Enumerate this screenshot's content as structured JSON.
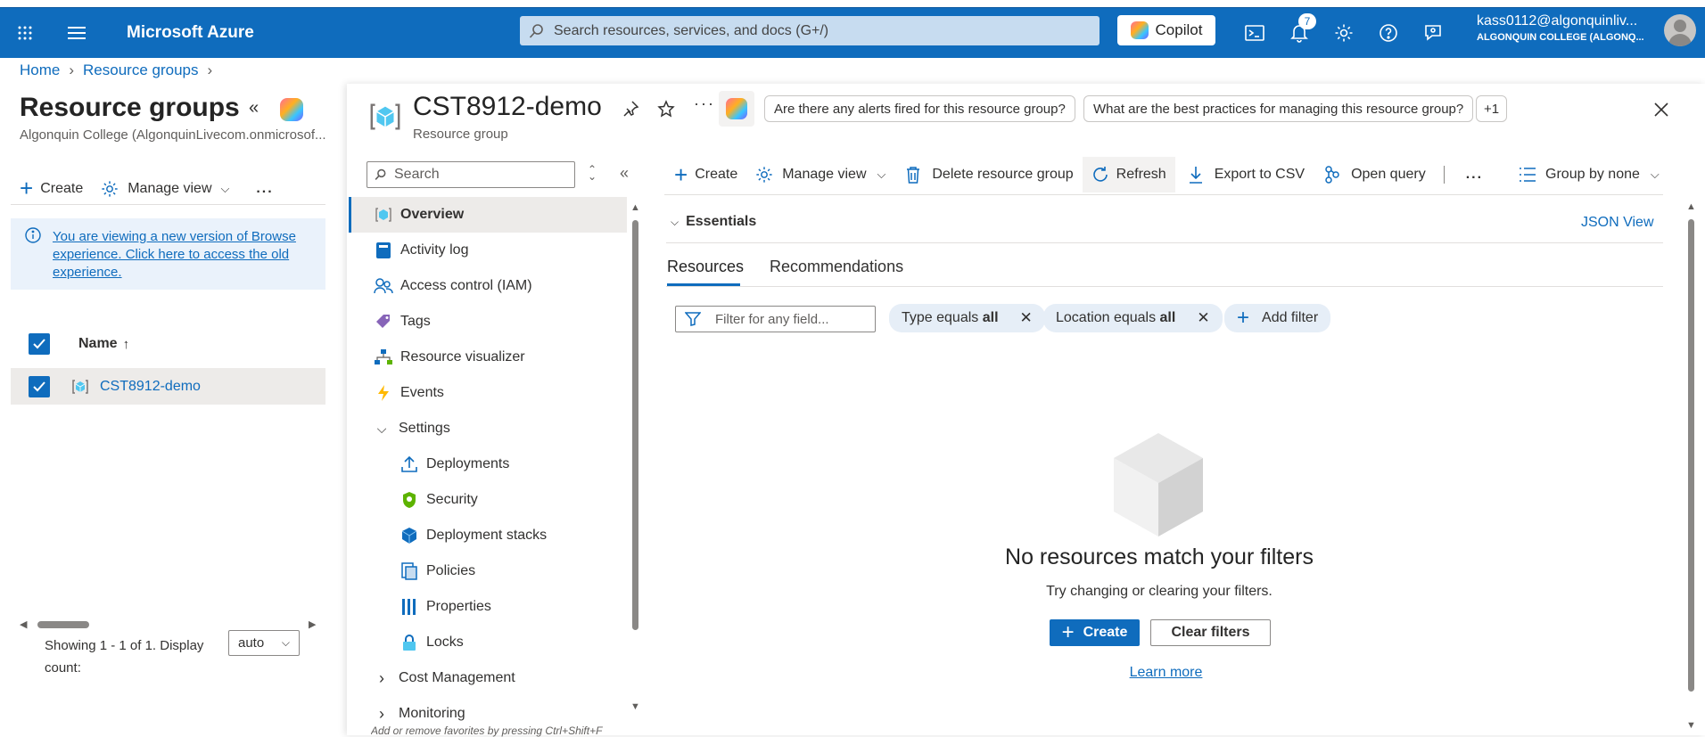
{
  "topbar": {
    "brand": "Microsoft Azure",
    "search_placeholder": "Search resources, services, and docs (G+/)",
    "copilot_label": "Copilot",
    "notification_count": "7",
    "account_email": "kass0112@algonquinliv...",
    "account_org": "ALGONQUIN COLLEGE (ALGONQ..."
  },
  "breadcrumb": {
    "home": "Home",
    "resource_groups": "Resource groups"
  },
  "left": {
    "title": "Resource groups",
    "subtitle": "Algonquin College (AlgonquinLivecom.onmicrosof...",
    "create": "Create",
    "manage_view": "Manage view",
    "more": "...",
    "info_text": "You are viewing a new version of Browse experience. Click here to access the old experience.",
    "col_name": "Name",
    "sort_glyph": "↑",
    "rows": [
      {
        "name": "CST8912-demo"
      }
    ],
    "paging_text": "Showing 1 - 1 of 1. Display count:",
    "display_count": "auto"
  },
  "blade": {
    "title": "CST8912-demo",
    "subtitle": "Resource group",
    "suggestions": [
      "Are there any alerts fired for this resource group?",
      "What are the best practices for managing this resource group?",
      "+1"
    ]
  },
  "menu": {
    "search_placeholder": "Search",
    "items": [
      {
        "label": "Overview",
        "icon": "cube-icon"
      },
      {
        "label": "Activity log",
        "icon": "log-icon"
      },
      {
        "label": "Access control (IAM)",
        "icon": "people-icon"
      },
      {
        "label": "Tags",
        "icon": "tag-icon"
      },
      {
        "label": "Resource visualizer",
        "icon": "visualizer-icon"
      },
      {
        "label": "Events",
        "icon": "lightning-icon"
      }
    ],
    "settings_label": "Settings",
    "settings_items": [
      {
        "label": "Deployments",
        "icon": "upload-icon"
      },
      {
        "label": "Security",
        "icon": "shield-icon"
      },
      {
        "label": "Deployment stacks",
        "icon": "stack-icon"
      },
      {
        "label": "Policies",
        "icon": "policy-icon"
      },
      {
        "label": "Properties",
        "icon": "properties-icon"
      },
      {
        "label": "Locks",
        "icon": "lock-icon"
      }
    ],
    "cost_label": "Cost Management",
    "monitoring_label": "Monitoring",
    "footer_hint": "Add or remove favorites by pressing Ctrl+Shift+F"
  },
  "toolbar": {
    "create": "Create",
    "manage_view": "Manage view",
    "delete": "Delete resource group",
    "refresh": "Refresh",
    "export": "Export to CSV",
    "open_query": "Open query",
    "more": "...",
    "group_by": "Group by none"
  },
  "essentials": {
    "label": "Essentials",
    "json_view": "JSON View"
  },
  "tabs": {
    "resources": "Resources",
    "recommendations": "Recommendations"
  },
  "filters": {
    "placeholder": "Filter for any field...",
    "type_prefix": "Type equals ",
    "type_value": "all",
    "location_prefix": "Location equals ",
    "location_value": "all",
    "add_filter": "Add filter"
  },
  "empty": {
    "title": "No resources match your filters",
    "subtitle": "Try changing or clearing your filters.",
    "create": "Create",
    "clear": "Clear filters",
    "learn_more": "Learn more"
  },
  "colors": {
    "azure_blue": "#0f6cbd",
    "selected_bg": "#edebe9"
  }
}
